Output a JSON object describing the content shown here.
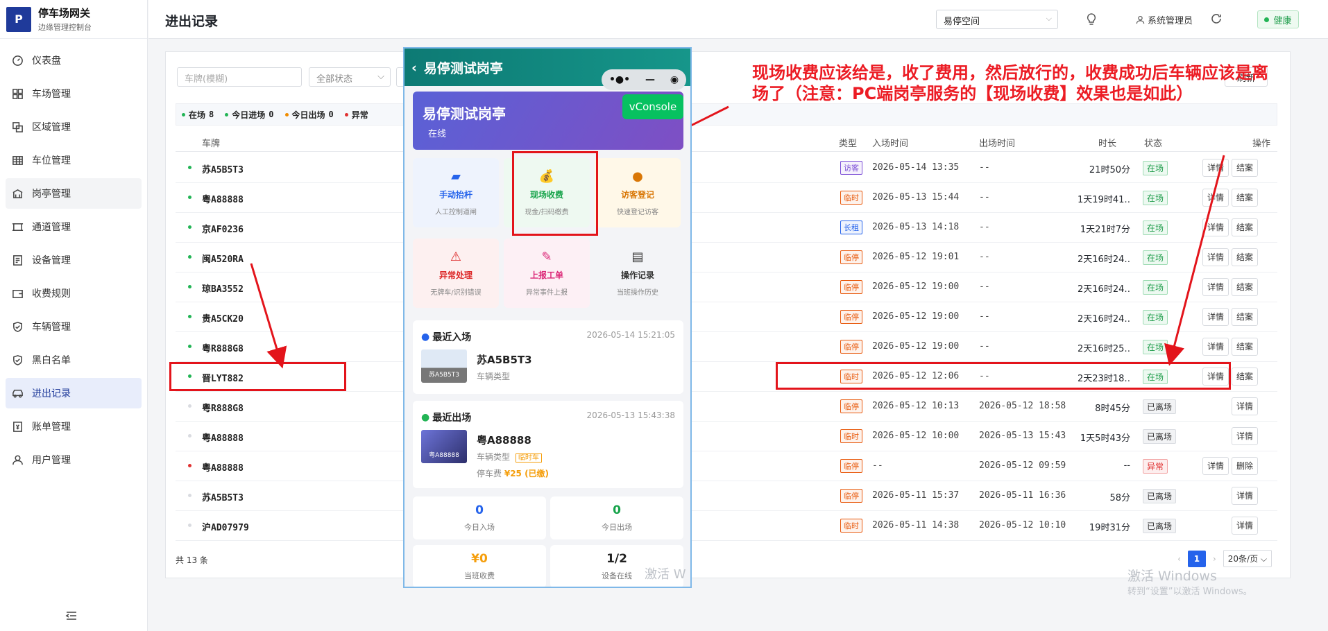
{
  "brand": {
    "title": "停车场网关",
    "subtitle": "边缘管理控制台",
    "logo": "P"
  },
  "sidebar": {
    "items": [
      {
        "label": "仪表盘",
        "icon": "dashboard-icon"
      },
      {
        "label": "车场管理",
        "icon": "grid-icon"
      },
      {
        "label": "区域管理",
        "icon": "layers-icon"
      },
      {
        "label": "车位管理",
        "icon": "table-icon"
      },
      {
        "label": "岗亭管理",
        "icon": "booth-icon"
      },
      {
        "label": "通道管理",
        "icon": "channel-icon"
      },
      {
        "label": "设备管理",
        "icon": "device-icon"
      },
      {
        "label": "收费规则",
        "icon": "wallet-icon"
      },
      {
        "label": "车辆管理",
        "icon": "shield-icon"
      },
      {
        "label": "黑白名单",
        "icon": "shield-icon"
      },
      {
        "label": "进出记录",
        "icon": "car-icon"
      },
      {
        "label": "账单管理",
        "icon": "bill-icon"
      },
      {
        "label": "用户管理",
        "icon": "user-icon"
      }
    ]
  },
  "header": {
    "title": "进出记录",
    "space": "易停空间",
    "user": "系统管理员",
    "health": "健康"
  },
  "filters": {
    "plate_placeholder": "车牌(模糊)",
    "status": "全部状态",
    "refresh": "刷新"
  },
  "stats": [
    {
      "label": "在场",
      "value": "8",
      "color": "#22b455"
    },
    {
      "label": "今日进场",
      "value": "0",
      "color": "#22b455"
    },
    {
      "label": "今日出场",
      "value": "0",
      "color": "#f08c00"
    },
    {
      "label": "异常",
      "value": "",
      "color": "#e03131"
    }
  ],
  "table": {
    "headers": {
      "plate": "车牌",
      "type": "类型",
      "in_time": "入场时间",
      "out_time": "出场时间",
      "duration": "时长",
      "status": "状态",
      "action": "操作"
    },
    "rows": [
      {
        "dot": "#22b455",
        "plate": "苏A5B5T3",
        "type": "访客",
        "type_color": "#7b4dd6",
        "in": "2026-05-14 13:35",
        "out": "--",
        "dur": "21时50分",
        "status": "在场",
        "st": "in",
        "actions": [
          "详情",
          "结案"
        ]
      },
      {
        "dot": "#22b455",
        "plate": "粤A88888",
        "type": "临时",
        "type_color": "#e8590c",
        "in": "2026-05-13 15:44",
        "out": "--",
        "dur": "1天19时41…",
        "status": "在场",
        "st": "in",
        "actions": [
          "详情",
          "结案"
        ]
      },
      {
        "dot": "#22b455",
        "plate": "京AF0236",
        "type": "长租",
        "type_color": "#2563eb",
        "in": "2026-05-13 14:18",
        "out": "--",
        "dur": "1天21时7分",
        "status": "在场",
        "st": "in",
        "actions": [
          "详情",
          "结案"
        ]
      },
      {
        "dot": "#22b455",
        "plate": "闽A520RA",
        "type": "临停",
        "type_color": "#e8590c",
        "in": "2026-05-12 19:01",
        "out": "--",
        "dur": "2天16时24…",
        "status": "在场",
        "st": "in",
        "actions": [
          "详情",
          "结案"
        ]
      },
      {
        "dot": "#22b455",
        "plate": "琼BA3552",
        "type": "临停",
        "type_color": "#e8590c",
        "in": "2026-05-12 19:00",
        "out": "--",
        "dur": "2天16时24…",
        "status": "在场",
        "st": "in",
        "actions": [
          "详情",
          "结案"
        ]
      },
      {
        "dot": "#22b455",
        "plate": "贵A5CK20",
        "type": "临停",
        "type_color": "#e8590c",
        "in": "2026-05-12 19:00",
        "out": "--",
        "dur": "2天16时24…",
        "status": "在场",
        "st": "in",
        "actions": [
          "详情",
          "结案"
        ]
      },
      {
        "dot": "#22b455",
        "plate": "粤R888G8",
        "type": "临停",
        "type_color": "#e8590c",
        "in": "2026-05-12 19:00",
        "out": "--",
        "dur": "2天16时25…",
        "status": "在场",
        "st": "in",
        "actions": [
          "详情",
          "结案"
        ]
      },
      {
        "dot": "#22b455",
        "plate": "晋LYT882",
        "type": "临时",
        "type_color": "#e8590c",
        "in": "2026-05-12 12:06",
        "out": "--",
        "dur": "2天23时18…",
        "status": "在场",
        "st": "in",
        "actions": [
          "详情",
          "结案"
        ]
      },
      {
        "dot": "#d9dbe0",
        "plate": "粤R888G8",
        "type": "临停",
        "type_color": "#e8590c",
        "in": "2026-05-12 10:13",
        "out": "2026-05-12 18:58",
        "dur": "8时45分",
        "status": "已离场",
        "st": "out",
        "actions": [
          "详情"
        ]
      },
      {
        "dot": "#d9dbe0",
        "plate": "粤A88888",
        "type": "临时",
        "type_color": "#e8590c",
        "in": "2026-05-12 10:00",
        "out": "2026-05-13 15:43",
        "dur": "1天5时43分",
        "status": "已离场",
        "st": "out",
        "actions": [
          "详情"
        ]
      },
      {
        "dot": "#e03131",
        "plate": "粤A88888",
        "type": "临停",
        "type_color": "#e8590c",
        "in": "--",
        "out": "2026-05-12 09:59",
        "dur": "--",
        "status": "异常",
        "st": "err",
        "actions": [
          "详情",
          "删除"
        ]
      },
      {
        "dot": "#d9dbe0",
        "plate": "苏A5B5T3",
        "type": "临停",
        "type_color": "#e8590c",
        "in": "2026-05-11 15:37",
        "out": "2026-05-11 16:36",
        "dur": "58分",
        "status": "已离场",
        "st": "out",
        "actions": [
          "详情"
        ]
      },
      {
        "dot": "#d9dbe0",
        "plate": "沪AD07979",
        "type": "临时",
        "type_color": "#e8590c",
        "in": "2026-05-11 14:38",
        "out": "2026-05-12 10:10",
        "dur": "19时31分",
        "status": "已离场",
        "st": "out",
        "actions": [
          "详情"
        ]
      }
    ]
  },
  "footer": {
    "total": "共 13 条",
    "page": "1",
    "page_size": "20条/页"
  },
  "annotation": {
    "text": "现场收费应该给是，收了费用，然后放行的，收费成功后车辆应该是离场了（注意：PC端岗亭服务的【现场收费】效果也是如此）"
  },
  "phone": {
    "title": "易停测试岗亭",
    "banner_title": "易停测试岗亭",
    "banner_status": "在线",
    "vconsole": "vConsole",
    "tiles": [
      {
        "label": "手动抬杆",
        "desc": "人工控制道闸",
        "icon": "barrier-icon",
        "glyph": "▰",
        "color": "#2563eb",
        "bg": "#eef3fd"
      },
      {
        "label": "现场收费",
        "desc": "现金/扫码缴费",
        "icon": "money-bag-icon",
        "glyph": "💰",
        "color": "#16a34a",
        "bg": "#eef9f1"
      },
      {
        "label": "访客登记",
        "desc": "快速登记访客",
        "icon": "visitor-icon",
        "glyph": "●",
        "color": "#d97706",
        "bg": "#fff8e8"
      },
      {
        "label": "异常处理",
        "desc": "无牌车/识别错误",
        "icon": "warning-icon",
        "glyph": "⚠",
        "color": "#dc2626",
        "bg": "#fdf0f0"
      },
      {
        "label": "上报工单",
        "desc": "异常事件上报",
        "icon": "edit-icon",
        "glyph": "✎",
        "color": "#db2777",
        "bg": "#fdf0f5"
      },
      {
        "label": "操作记录",
        "desc": "当班操作历史",
        "icon": "clipboard-icon",
        "glyph": "▤",
        "color": "#333333",
        "bg": "#f3f4f7"
      }
    ],
    "recent_in": {
      "title": "最近入场",
      "time": "2026-05-14 15:21:05",
      "plate": "苏A5B5T3",
      "type": "车辆类型",
      "img_plate": "苏A5B5T3"
    },
    "recent_out": {
      "title": "最近出场",
      "time": "2026-05-13 15:43:38",
      "plate": "粤A88888",
      "type": "车辆类型",
      "tag": "临时车",
      "fee_label": "停车费",
      "fee": "¥25 (已缴)",
      "img_plate": "粤A88888"
    },
    "stats": [
      {
        "value": "0",
        "label": "今日入场",
        "color": "#2563eb"
      },
      {
        "value": "0",
        "label": "今日出场",
        "color": "#16a34a"
      },
      {
        "value": "¥0",
        "label": "当班收费",
        "color": "#f59e0b"
      },
      {
        "value": "1/2",
        "label": "设备在线",
        "color": "#222222"
      }
    ]
  },
  "watermark": {
    "line1": "激活 Windows",
    "line2": "转到“设置”以激活 Windows。",
    "phone": "激活 W"
  }
}
